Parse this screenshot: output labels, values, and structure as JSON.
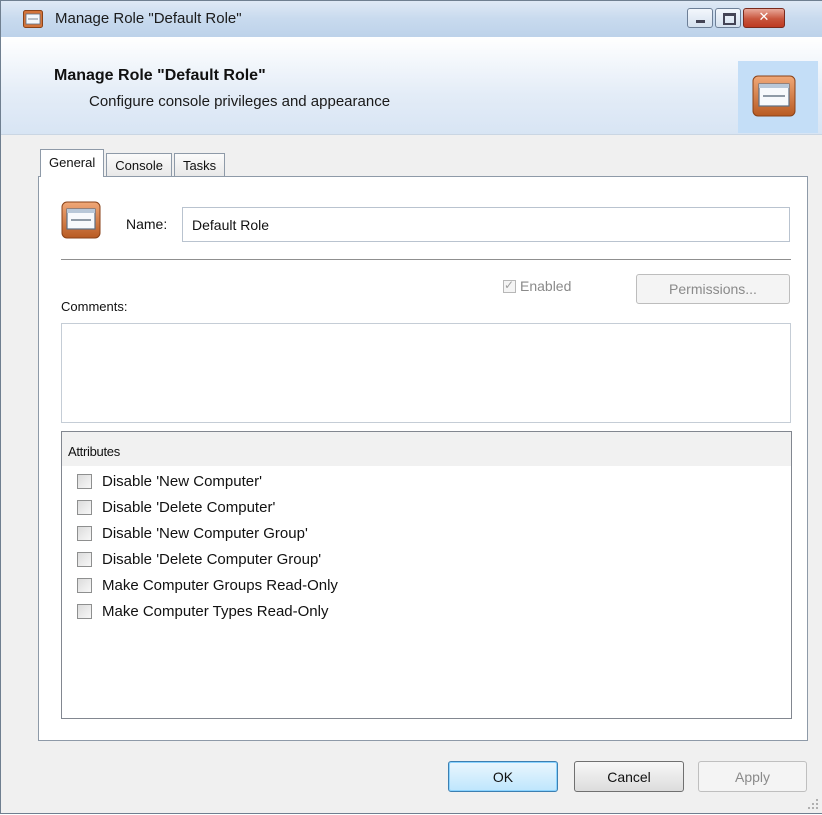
{
  "window": {
    "title": "Manage Role \"Default Role\"",
    "controls": [
      "minimize",
      "maximize",
      "close"
    ]
  },
  "header": {
    "title": "Manage Role \"Default Role\"",
    "subtitle": "Configure console privileges and appearance"
  },
  "tabs": [
    {
      "label": "General",
      "active": true
    },
    {
      "label": "Console",
      "active": false
    },
    {
      "label": "Tasks",
      "active": false
    }
  ],
  "general": {
    "name_label": "Name:",
    "name_value": "Default Role",
    "enabled_label": "Enabled",
    "enabled_checked": true,
    "enabled_disabled": true,
    "permissions_label": "Permissions...",
    "comments_label": "Comments:",
    "comments_value": "",
    "attributes_header": "Attributes",
    "attributes": [
      {
        "label": "Disable 'New Computer'",
        "checked": false
      },
      {
        "label": "Disable 'Delete Computer'",
        "checked": false
      },
      {
        "label": "Disable 'New Computer Group'",
        "checked": false
      },
      {
        "label": "Disable 'Delete Computer Group'",
        "checked": false
      },
      {
        "label": "Make Computer Groups Read-Only",
        "checked": false
      },
      {
        "label": "Make Computer Types Read-Only",
        "checked": false
      }
    ]
  },
  "buttons": {
    "ok": "OK",
    "cancel": "Cancel",
    "apply": "Apply"
  },
  "colors": {
    "accent": "#c4def7",
    "role_icon": "#d4743a",
    "window_frame": "#bdd2ea"
  }
}
